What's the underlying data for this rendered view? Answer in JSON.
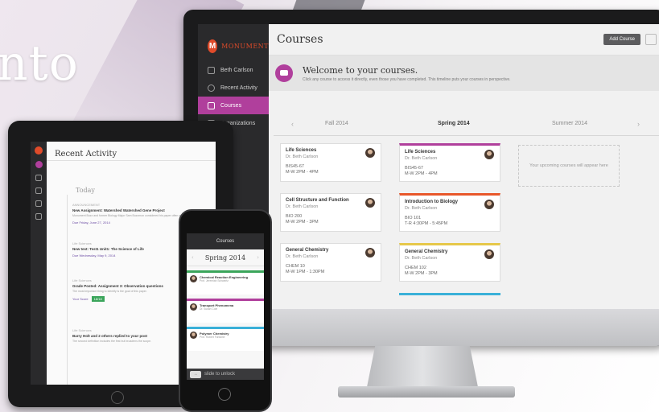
{
  "hero": {
    "text": "nto"
  },
  "desktop": {
    "brand": {
      "logo_letter": "M",
      "name": "MONUMENT"
    },
    "sidebar": {
      "items": [
        {
          "label": "Beth Carlson",
          "icon": "user-icon"
        },
        {
          "label": "Recent Activity",
          "icon": "clock-icon"
        },
        {
          "label": "Courses",
          "icon": "book-icon",
          "active": true
        },
        {
          "label": "Organizations",
          "icon": "group-icon"
        }
      ]
    },
    "header": {
      "title": "Courses",
      "add_course_label": "Add Course"
    },
    "welcome": {
      "title": "Welcome to your courses.",
      "subtitle": "Click any course to access it directly, even those you have completed. This timeline puts your courses in perspective."
    },
    "terms": {
      "prev": "Fall 2014",
      "current": "Spring 2014",
      "next": "Summer 2014"
    },
    "courses_fall": [
      {
        "title": "Life Sciences",
        "prof": "Dr. Beth Carlson",
        "code": "BIS45-67",
        "time": "M-W 2PM - 4PM"
      },
      {
        "title": "Cell Structure and Function",
        "prof": "Dr. Beth Carlson",
        "code": "BIO 200",
        "time": "M-W 2PM - 3PM"
      },
      {
        "title": "General Chemistry",
        "prof": "Dr. Beth Carlson",
        "code": "CHEM 10",
        "time": "M-W 1PM - 1:30PM"
      }
    ],
    "courses_spring": [
      {
        "title": "Life Sciences",
        "prof": "Dr. Beth Carlson",
        "code": "BIS45-67",
        "time": "M-W 2PM - 4PM",
        "color": "#b03f9c"
      },
      {
        "title": "Introduction to Biology",
        "prof": "Dr. Beth Carlson",
        "code": "BIO 101",
        "time": "T-R 4:30PM - 5:45PM",
        "color": "#e8572a"
      },
      {
        "title": "General Chemistry",
        "prof": "Dr. Beth Carlson",
        "code": "CHEM 102",
        "time": "M-W 2PM - 3PM",
        "color": "#e6c84a"
      }
    ],
    "placeholder": "Your upcoming courses will appear here"
  },
  "tablet": {
    "title": "Recent Activity",
    "today": "Today",
    "activities": [
      {
        "meta": "ANNOUNCEMENT",
        "head": "New Assignment: Watershed Watershed Gene Project",
        "body": "Monument Buzz and former Biology Major Sam Buzzmon considered his paper often after all the talk.",
        "foot": "Due Friday, June 27, 2014"
      },
      {
        "meta": "Life Sciences",
        "head": "New test: Test1 Unit1: The Science of Life",
        "body": "",
        "foot": "Due Wednesday, May 9, 2014"
      },
      {
        "meta": "Life Sciences",
        "head": "Grade Posted: Assignment 3: Observation questions",
        "body": "The most important thing to identify is the goal of this paper.",
        "foot": "Your Score",
        "score": "18/18"
      },
      {
        "meta": "Life Sciences",
        "head": "Barry Holt and 2 others replied to your post",
        "body": "The second definition includes the first but broadens the scope.",
        "foot": ""
      }
    ]
  },
  "phone": {
    "carrier": "CARRIER",
    "title": "Courses",
    "term": "Spring 2014",
    "courses": [
      {
        "title": "Chemical Reaction Engineering",
        "prof": "Prof. Jeremiah Schwartz",
        "color": "#3ba55b"
      },
      {
        "title": "Transport Phenomena",
        "prof": "Dr. Susan Cole",
        "color": "#b03f9c"
      },
      {
        "title": "Polymer Chemistry",
        "prof": "Prof. Robert Fontaine",
        "color": "#3ab0d8"
      }
    ],
    "slide_label": "slide to unlock"
  }
}
